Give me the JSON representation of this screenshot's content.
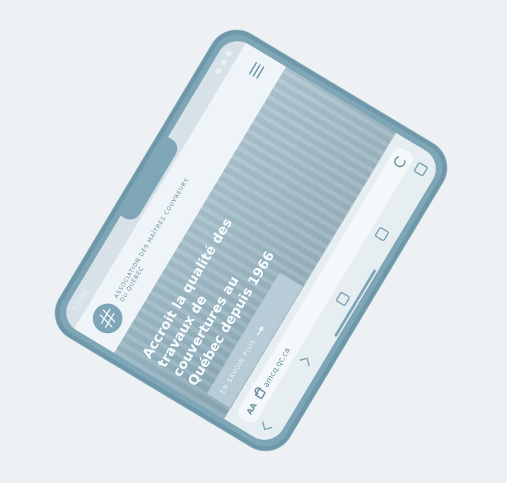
{
  "status": {
    "time": "10:50"
  },
  "header": {
    "org_name": "Association des maîtres couvreurs du Québec"
  },
  "hero": {
    "title": "Accroit la qualité des travaux de couvertures au Québec depuis 1966",
    "cta": "En savoir plus"
  },
  "browser": {
    "aa": "AA",
    "url": "amcq.qc.ca"
  },
  "colors": {
    "frame": "#7fa6b7",
    "accent": "#6e97aa",
    "screen_bg": "#d7e2e8"
  }
}
